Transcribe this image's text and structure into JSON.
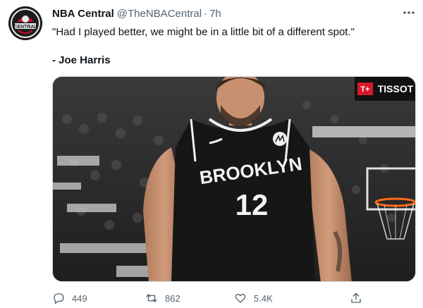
{
  "tweet": {
    "display_name": "NBA Central",
    "handle": "@TheNBACentral",
    "separator": "·",
    "time": "7h",
    "quote": "\"Had I played better, we might be in a little bit of a different spot.\"",
    "author": "- Joe Harris",
    "avatar": {
      "icon": "nba-central-logo",
      "text": "CENTRAL"
    },
    "media": {
      "jersey_team": "BROOKLYN",
      "jersey_number": "12",
      "sponsor_sign": "TISSOT",
      "sponsor_mark": "T+"
    }
  },
  "actions": {
    "reply": {
      "icon": "reply-icon",
      "count": "449"
    },
    "retweet": {
      "icon": "retweet-icon",
      "count": "862"
    },
    "like": {
      "icon": "heart-icon",
      "count": "5.4K"
    },
    "share": {
      "icon": "share-icon"
    }
  },
  "more": {
    "icon": "more-icon"
  }
}
